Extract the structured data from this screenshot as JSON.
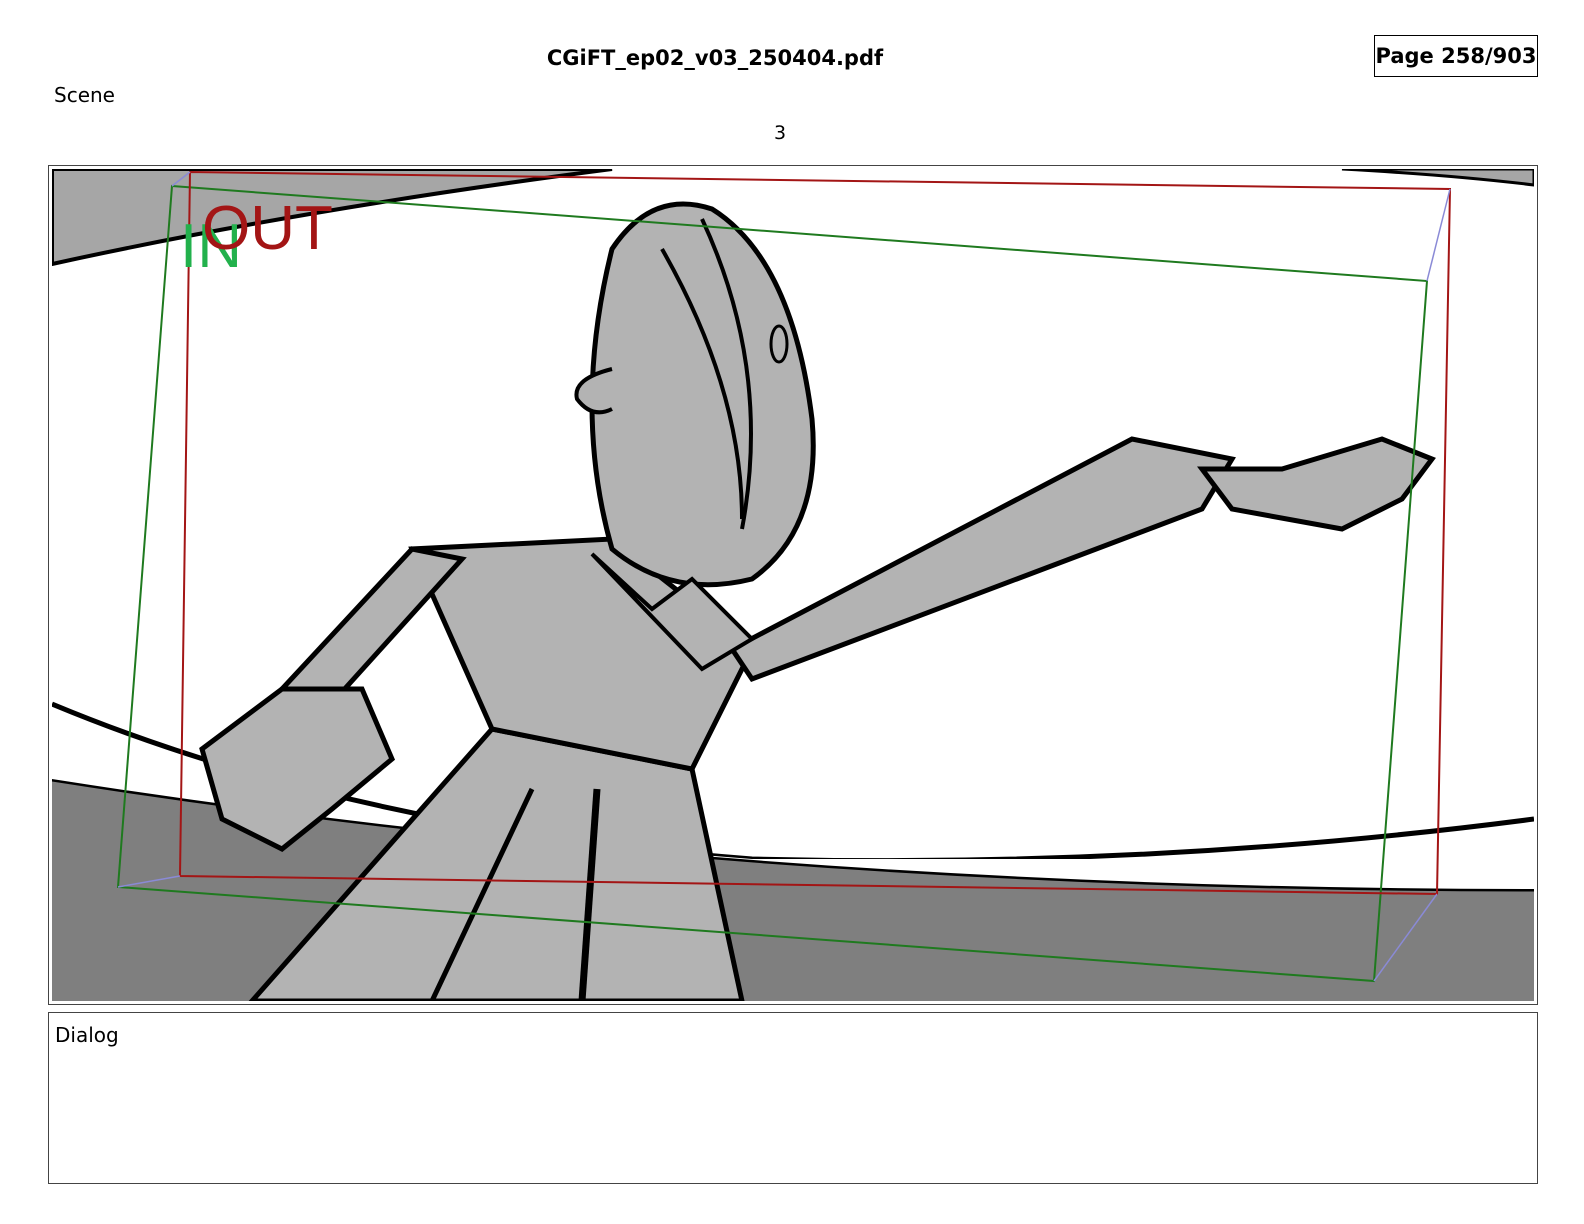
{
  "header": {
    "document_title": "CGiFT_ep02_v03_250404.pdf",
    "page_indicator": "Page 258/903"
  },
  "scene": {
    "label": "Scene",
    "number": "3"
  },
  "panel": {
    "in_marker": "IN",
    "out_marker": "OUT",
    "colors": {
      "in_frame": "#1f7a1f",
      "in_text": "#22b14c",
      "out_frame": "#a31515",
      "camera_arrow": "#8a8ad6",
      "figure_fill": "#b3b3b3",
      "floor": "#7f7f7f"
    }
  },
  "dialog": {
    "label": "Dialog",
    "text": ""
  }
}
